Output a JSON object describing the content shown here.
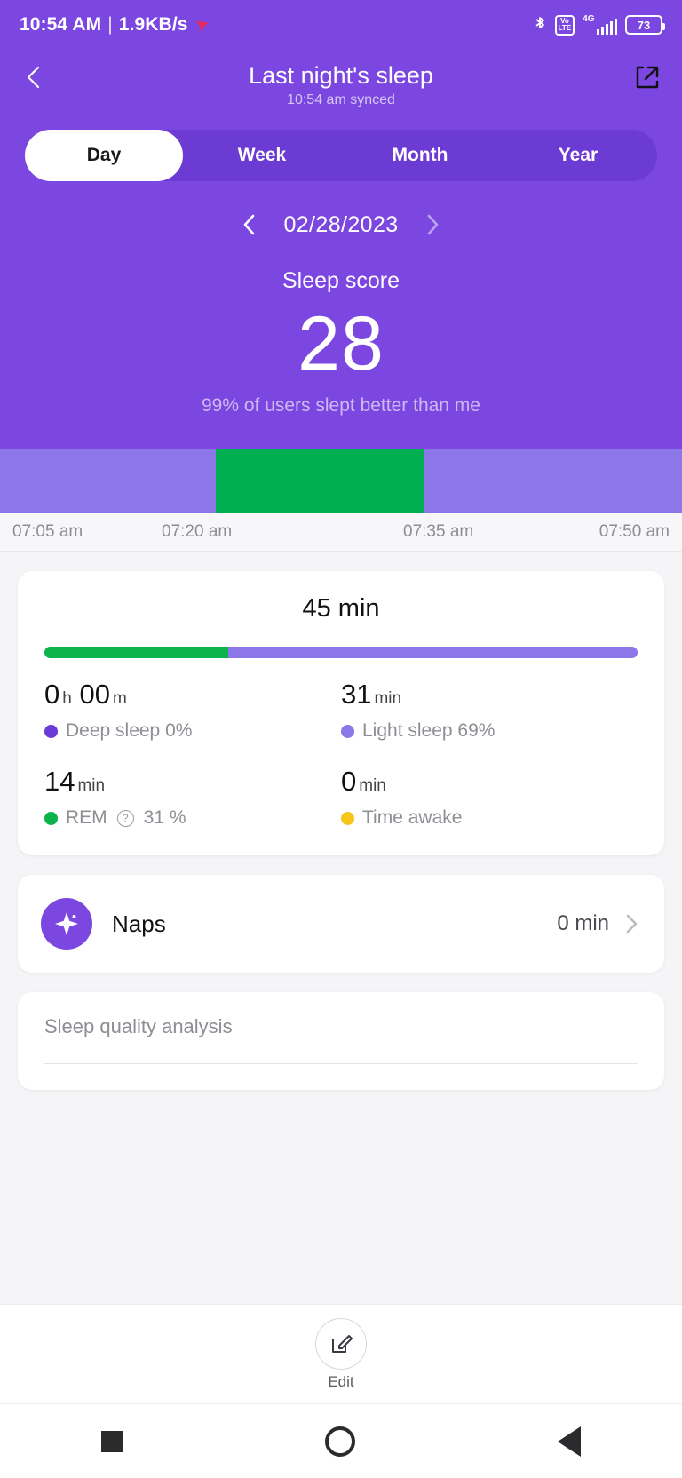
{
  "status_bar": {
    "time": "10:54 AM",
    "separator": "|",
    "network_speed": "1.9KB/s",
    "speed_icon": "upload-arrow-icon",
    "bluetooth_icon": "bluetooth-icon",
    "volte_line1": "Vo",
    "volte_line2": "LTE",
    "network_type": "4G",
    "signal_icon": "signal-bars-icon",
    "battery_level": "73"
  },
  "app_bar": {
    "back_icon": "back-chevron-icon",
    "title": "Last night's sleep",
    "subtitle": "10:54 am synced",
    "share_icon": "share-external-icon"
  },
  "tabs": [
    {
      "label": "Day",
      "active": true
    },
    {
      "label": "Week",
      "active": false
    },
    {
      "label": "Month",
      "active": false
    },
    {
      "label": "Year",
      "active": false
    }
  ],
  "date_selector": {
    "prev_icon": "chevron-left-icon",
    "date": "02/28/2023",
    "next_icon": "chevron-right-icon"
  },
  "sleep_score": {
    "label": "Sleep score",
    "value": "28",
    "comparison": "99% of users slept better than me"
  },
  "chart_data": {
    "type": "bar",
    "title": "Sleep stage hypnogram",
    "xlabel": "",
    "ylabel": "",
    "tick_labels": [
      "07:05 am",
      "07:20 am",
      "07:35 am",
      "07:50 am"
    ],
    "categories": [
      "Light sleep",
      "REM",
      "Light sleep"
    ],
    "values": [
      31.6,
      30.5,
      37.9
    ],
    "colors": [
      "#8b77e8",
      "#00b050",
      "#8b77e8"
    ],
    "grid": false,
    "legend_position": "none"
  },
  "stats_card": {
    "total_duration": "45 min",
    "progress_bar": {
      "green_percent": 31,
      "purple_percent": 69,
      "green_color": "#0cb34b",
      "purple_color": "#8b77e8"
    },
    "cells": [
      {
        "value": "0",
        "unit1": "h",
        "value2": "00",
        "unit2": "m",
        "label": "Deep sleep 0%",
        "dot_color": "#6a3ad6",
        "has_help_icon": false
      },
      {
        "value": "31",
        "unit1": "min",
        "value2": "",
        "unit2": "",
        "label": "Light sleep 69%",
        "dot_color": "#8b77e8",
        "has_help_icon": false
      },
      {
        "value": "14",
        "unit1": "min",
        "value2": "",
        "unit2": "",
        "label_before": "REM",
        "help_icon": "help-circle-icon",
        "label_after": "31 %",
        "label": "REM 31 %",
        "dot_color": "#0cb34b",
        "has_help_icon": true
      },
      {
        "value": "0",
        "unit1": "min",
        "value2": "",
        "unit2": "",
        "label": "Time awake",
        "dot_color": "#f5c518",
        "has_help_icon": false
      }
    ]
  },
  "naps_card": {
    "icon": "sparkle-star-icon",
    "label": "Naps",
    "value": "0 min",
    "chevron": "chevron-right-icon"
  },
  "quality_card": {
    "title": "Sleep quality analysis"
  },
  "edit_bar": {
    "icon": "edit-pencil-icon",
    "label": "Edit"
  },
  "nav_bar": {
    "recents_icon": "square-recents-icon",
    "home_icon": "circle-home-icon",
    "back_icon": "triangle-back-icon"
  },
  "theme": {
    "purple": "#7b47e0",
    "purple_dark": "#6c3bd4",
    "green": "#0cb34b",
    "light_purple": "#8b77e8"
  }
}
